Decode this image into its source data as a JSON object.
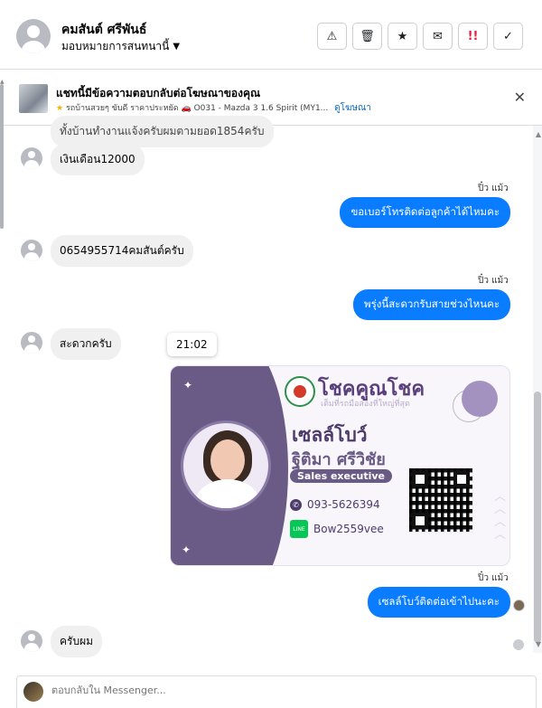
{
  "header": {
    "contact_name": "คมสันต์ ศรีพันธ์",
    "assign_label": "มอบหมายการสนทนานี้",
    "actions": [
      {
        "name": "report-button",
        "icon": "warning-icon",
        "glyph": "▲"
      },
      {
        "name": "delete-button",
        "icon": "trash-icon",
        "glyph": "🗑"
      },
      {
        "name": "star-button",
        "icon": "star-icon",
        "glyph": "★"
      },
      {
        "name": "mark-unread-button",
        "icon": "envelope-open-icon",
        "glyph": "✉"
      },
      {
        "name": "follow-up-button",
        "icon": "priority-icon",
        "glyph": "!!"
      },
      {
        "name": "mark-done-button",
        "icon": "check-icon",
        "glyph": "✓"
      }
    ]
  },
  "ad_banner": {
    "title": "แชทนี้มีข้อความตอบกลับต่อโฆษณาของคุณ",
    "subtitle": "รถบ้านสวยๆ ขับดี ราคาประหยัด 🚗 O031 - Mazda 3 1.6 Spirit (MY1...",
    "link": "ดูโฆษณา",
    "close": "✕"
  },
  "messages": {
    "cut_top": "ทั้งบ้านทำงานแจ้งครับผมตามยอด1854ครับ",
    "m1": "เงินเดือน12000",
    "sender1": "ปิ๋ว แม้ว",
    "m2": "ขอเบอร์โทรติดต่อลูกค้าได้ไหมคะ",
    "m3": "0654955714คมสันต์ครับ",
    "sender2": "ปิ๋ว แม้ว",
    "m4": "พรุ่งนี้สะดวกรับสายช่วงไหนคะ",
    "m5": "สะดวกครับ",
    "time": "21:02",
    "sender3": "ปิ๋ว แม้ว",
    "m6": "เซลล์โบว์ติดต่อเข้าไปนะคะ",
    "m7": "ครับผม"
  },
  "business_card": {
    "brand": "โชคคูณโชค",
    "brand_sub": "เต็มที่รถมือสองที่ใหญ่ที่สุด",
    "nickname": "เซลล์โบว์",
    "fullname": "ฐิติมา ศรีวิชัย",
    "role": "Sales executive",
    "phone": "093-5626394",
    "line_id": "Bow2559vee",
    "line_badge": "LINE"
  },
  "reply_box": {
    "placeholder": "ตอบกลับใน Messenger..."
  }
}
